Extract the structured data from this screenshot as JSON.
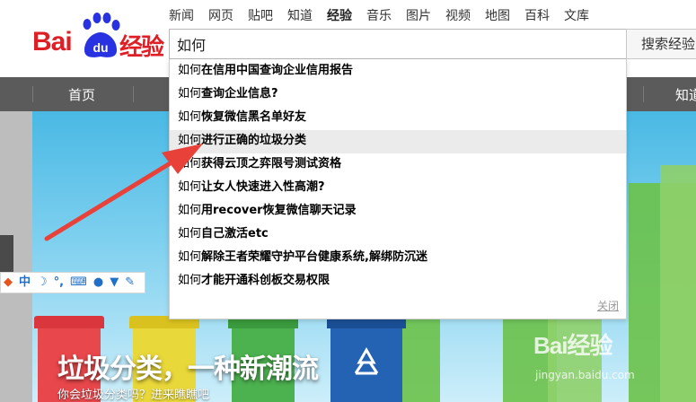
{
  "logo": {
    "bai": "Bai",
    "du": "du",
    "jingyan": "经验"
  },
  "nav": [
    {
      "label": "新闻",
      "active": false
    },
    {
      "label": "网页",
      "active": false
    },
    {
      "label": "贴吧",
      "active": false
    },
    {
      "label": "知道",
      "active": false
    },
    {
      "label": "经验",
      "active": true
    },
    {
      "label": "音乐",
      "active": false
    },
    {
      "label": "图片",
      "active": false
    },
    {
      "label": "视频",
      "active": false
    },
    {
      "label": "地图",
      "active": false
    },
    {
      "label": "百科",
      "active": false
    },
    {
      "label": "文库",
      "active": false
    }
  ],
  "search": {
    "value": "如何",
    "button_label": "搜索经验"
  },
  "menubar": {
    "home": "首页",
    "right": "知道"
  },
  "suggestions": [
    {
      "prefix": "如何",
      "rest": "在信用中国查询企业信用报告"
    },
    {
      "prefix": "如何",
      "rest": "查询企业信息?"
    },
    {
      "prefix": "如何",
      "rest": "恢复微信黑名单好友"
    },
    {
      "prefix": "如何",
      "rest": "进行正确的垃圾分类"
    },
    {
      "prefix": "如何",
      "rest": "获得云顶之弈限号测试资格"
    },
    {
      "prefix": "如何",
      "rest": "让女人快速进入性高潮?"
    },
    {
      "prefix": "如何",
      "rest": "用recover恢复微信聊天记录"
    },
    {
      "prefix": "如何",
      "rest": "自己激活etc"
    },
    {
      "prefix": "如何",
      "rest": "解除王者荣耀守护平台健康系统,解绑防沉迷"
    },
    {
      "prefix": "如何",
      "rest": "才能开通科创板交易权限"
    }
  ],
  "highlighted_index": 3,
  "close_label": "关闭",
  "banner": {
    "title": "垃圾分类，一种新潮流",
    "subtitle": "你会垃圾分类吗？进来瞧瞧吧"
  },
  "watermark": {
    "logo": "Bai经验",
    "url": "jingyan.baidu.com"
  },
  "ime": {
    "lang": "中"
  },
  "colors": {
    "brand_red": "#de1f26",
    "brand_blue": "#2932e1",
    "menubar": "#5b5b5b",
    "arrow": "#e8413a"
  }
}
